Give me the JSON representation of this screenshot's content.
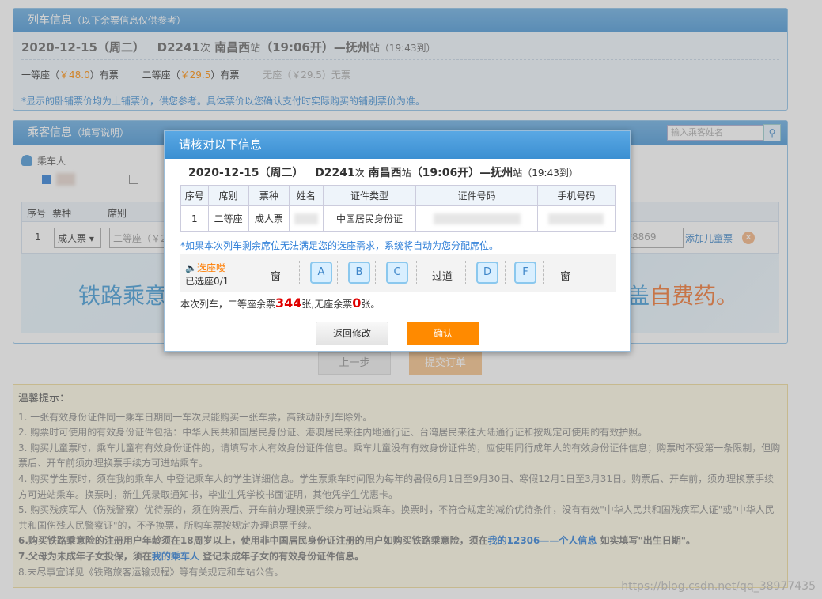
{
  "train_panel": {
    "title": "列车信息",
    "subtitle": "（以下余票信息仅供参考）",
    "date": "2020-12-15（周二）",
    "train_no": "D2241",
    "ci": "次",
    "from_station": "南昌西",
    "zhan": "站",
    "depart": "（19:06开）",
    "dash_arrow": "—",
    "to_station": "抚州",
    "zhan2": "站",
    "arrive": "（19:43到）",
    "seats": [
      {
        "name": "一等座（",
        "price": "￥48.0",
        "status": "）有票"
      },
      {
        "name": "二等座（",
        "price": "￥29.5",
        "status": "）有票"
      },
      {
        "name": "无座（￥29.5）无票"
      }
    ],
    "note": "*显示的卧铺票价均为上铺票价，供您参考。具体票价以您确认支付时实际购买的铺别票价为准。"
  },
  "passenger_panel": {
    "title": "乘客信息",
    "subtitle": "（填写说明）",
    "search_placeholder": "输入乘客姓名",
    "passenger_label": "乘车人",
    "headers": [
      "序号",
      "票种",
      "席别"
    ],
    "row_no": "1",
    "ticket_type": "成人票 ▾",
    "seat_type": "二等座（￥2",
    "phone_tail": "*8869",
    "add_child": "添加儿童票",
    "banner_left": "铁路乘意",
    "banner_right_blue": "盖",
    "banner_right_orange": "自费药。"
  },
  "buttons": {
    "prev": "上一步",
    "submit": "提交订单"
  },
  "tips": {
    "title": "温馨提示：",
    "items": [
      "1. 一张有效身份证件同一乘车日期同一车次只能购买一张车票，高铁动卧列车除外。",
      "2. 购票时可使用的有效身份证件包括：中华人民共和国居民身份证、港澳居民来往内地通行证、台湾居民来往大陆通行证和按规定可使用的有效护照。",
      "3. 购买儿童票时，乘车儿童有有效身份证件的，请填写本人有效身份证件信息。乘车儿童没有有效身份证件的，应使用同行成年人的有效身份证件信息；购票时不受第一条限制，但购票后、开车前须办理换票手续方可进站乘车。",
      "4. 购买学生票时，须在我的乘车人 中登记乘车人的学生详细信息。学生票乘车时间限为每年的暑假6月1日至9月30日、寒假12月1日至3月31日。购票后、开车前，须办理换票手续方可进站乘车。换票时，新生凭录取通知书，毕业生凭学校书面证明，其他凭学生优惠卡。",
      "5. 购买残疾军人（伤残警察）优待票的，须在购票后、开车前办理换票手续方可进站乘车。换票时，不符合规定的减价优待条件，没有有效\"中华人民共和国残疾军人证\"或\"中华人民共和国伤残人民警察证\"的，不予换票，所购车票按规定办理退票手续。"
    ],
    "item6_a": "6.购买铁路乘意险的注册用户年龄须在18周岁以上，使用非中国居民身份证注册的用户如购买铁路乘意险，须在",
    "item6_link": "我的12306——个人信息",
    "item6_b": " 如实填写\"出生日期\"。",
    "item7_a": "7.父母为未成年子女投保，须在",
    "item7_link": "我的乘车人",
    "item7_b": " 登记未成年子女的有效身份证件信息。",
    "item8": "8.未尽事宜详见《铁路旅客运输规程》等有关规定和车站公告。"
  },
  "dialog": {
    "title": "请核对以下信息",
    "date": "2020-12-15（周二）",
    "train_no": "D2241",
    "ci": "次",
    "from_station": "南昌西",
    "zhan": "站",
    "depart": "（19:06开）",
    "to": "—抚州",
    "zhan2": "站",
    "arrive": "（19:43到）",
    "headers": [
      "序号",
      "席别",
      "票种",
      "姓名",
      "证件类型",
      "证件号码",
      "手机号码"
    ],
    "row": [
      "1",
      "二等座",
      "成人票",
      "",
      "中国居民身份证",
      "",
      ""
    ],
    "note": "*如果本次列车剩余席位无法满足您的选座需求，系统将自动为您分配席位。",
    "choose_label": "选座喽",
    "chosen_label": "已选座0/1",
    "window_left": "窗",
    "aisle": "过道",
    "window_right": "窗",
    "seat_letters": [
      "A",
      "B",
      "C",
      "D",
      "F"
    ],
    "remain_a": "本次列车，二等座余票",
    "remain_count": "344",
    "remain_b": "张,无座余票",
    "remain_zero": "0",
    "remain_c": "张。",
    "back_label": "返回修改",
    "confirm_label": "确认"
  },
  "watermark": "https://blog.csdn.net/qq_38977435"
}
